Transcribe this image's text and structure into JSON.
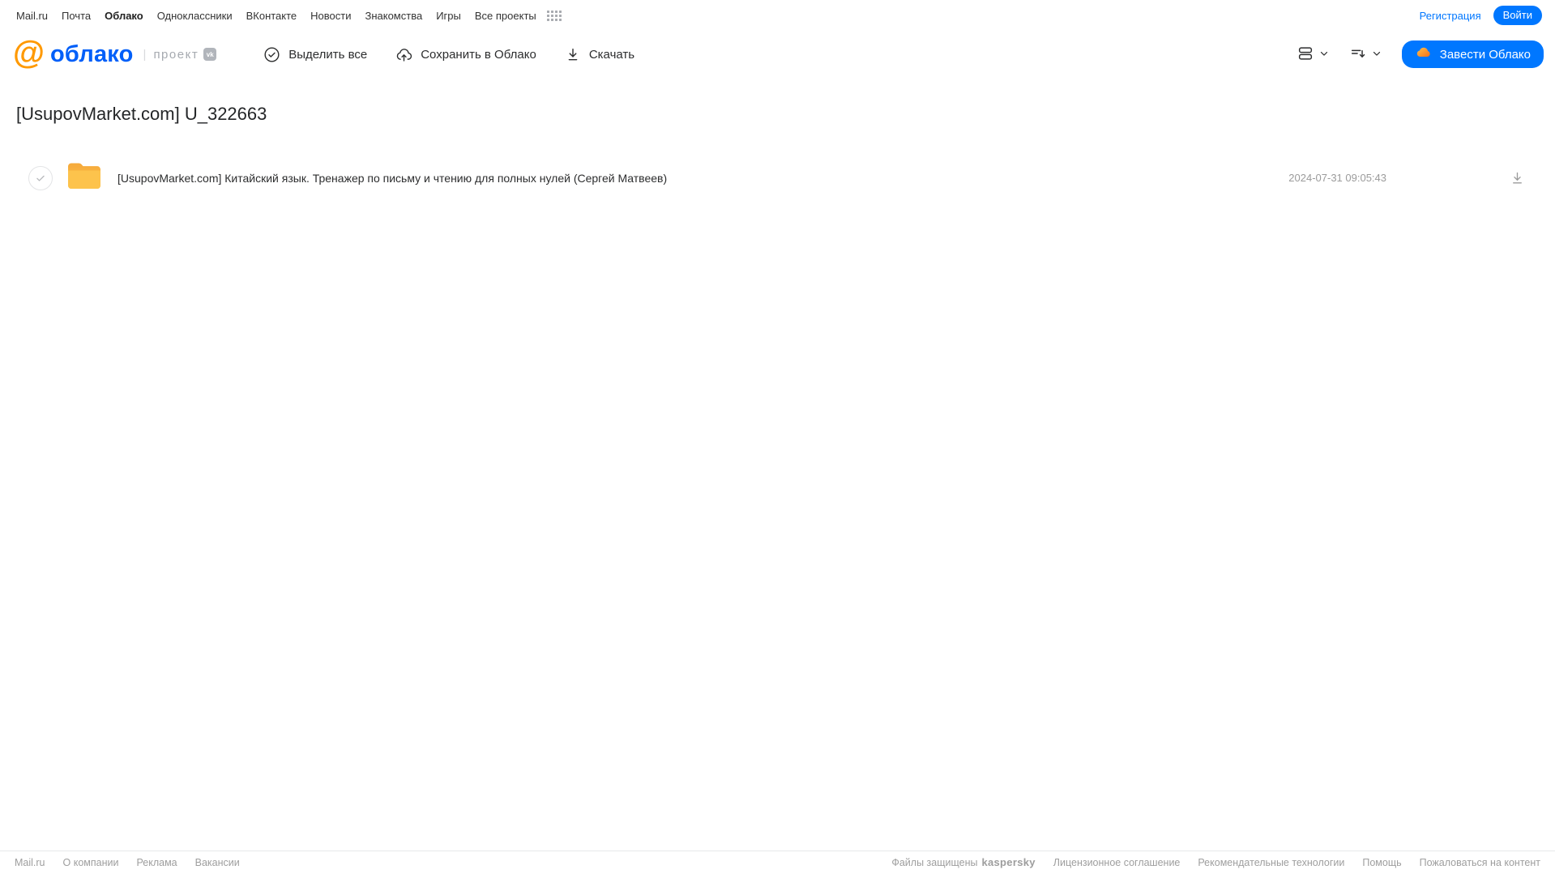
{
  "topnav": {
    "items": [
      {
        "label": "Mail.ru"
      },
      {
        "label": "Почта"
      },
      {
        "label": "Облако",
        "active": true
      },
      {
        "label": "Одноклассники"
      },
      {
        "label": "ВКонтакте"
      },
      {
        "label": "Новости"
      },
      {
        "label": "Знакомства"
      },
      {
        "label": "Игры"
      },
      {
        "label": "Все проекты"
      }
    ],
    "registration_label": "Регистрация",
    "login_label": "Войти"
  },
  "header": {
    "logo_at": "@",
    "logo_text": "облако",
    "logo_divider": "|",
    "project_label": "проект",
    "vk_badge": "vk",
    "actions": [
      {
        "label": "Выделить все",
        "icon": "check-circle-icon"
      },
      {
        "label": "Сохранить в Облако",
        "icon": "cloud-upload-icon"
      },
      {
        "label": "Скачать",
        "icon": "download-icon"
      }
    ],
    "view_control_icon": "view-toggle-icon",
    "sort_control_icon": "sort-icon",
    "create_cloud_label": "Завести Облако",
    "create_cloud_icon": "cloud-orange-icon"
  },
  "main": {
    "title": "[UsupovMarket.com] U_322663",
    "files": [
      {
        "name": "[UsupovMarket.com] Китайский язык. Тренажер по письму и чтению для полных нулей (Сергей Матвеев)",
        "date": "2024-07-31 09:05:43",
        "type": "folder",
        "checked": false
      }
    ]
  },
  "footer": {
    "left_links": [
      "Mail.ru",
      "О компании",
      "Реклама",
      "Вакансии"
    ],
    "protected_text": "Файлы защищены",
    "kaspersky_label": "kaspersky",
    "right_links": [
      "Лицензионное соглашение",
      "Рекомендательные технологии",
      "Помощь",
      "Пожаловаться на контент"
    ]
  },
  "colors": {
    "accent_blue": "#0077ff",
    "logo_blue": "#005ff9",
    "logo_orange": "#ff9900",
    "kaspersky_green": "#00a88e",
    "folder_yellow": "#fbbc42",
    "muted_gray": "#9b9b9b"
  }
}
